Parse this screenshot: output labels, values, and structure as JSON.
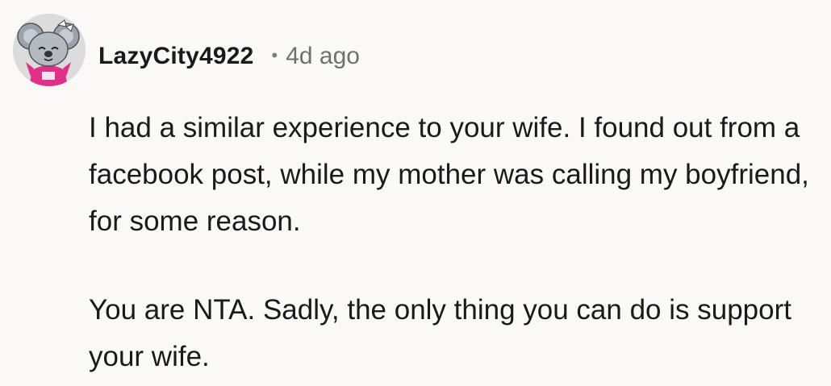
{
  "comment": {
    "author": "LazyCity4922",
    "separator": "•",
    "time_ago": "4d ago",
    "avatar_icon": "koala-avatar-icon",
    "paragraphs": [
      "I had a similar experience to your wife. I found out from a facebook post, while my mother was calling my boyfriend, for some reason.",
      "You are NTA. Sadly, the only thing you can do is support your wife."
    ]
  },
  "colors": {
    "background": "#fbf9f8",
    "text": "#1a1a1b",
    "meta": "#6f6f6f",
    "avatar_accent": "#e0318a"
  }
}
